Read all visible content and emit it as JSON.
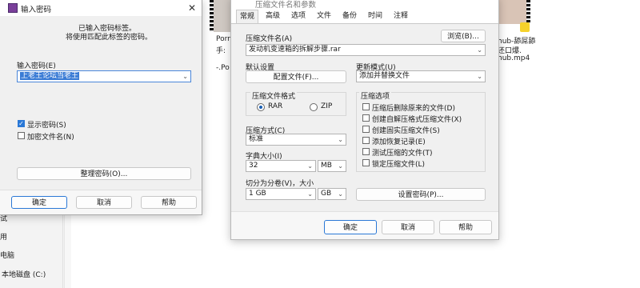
{
  "explorer": {
    "left_fragments": [
      "件",
      "片",
      "档",
      "",
      "",
      "",
      "MS",
      "器",
      "",
      "PS",
      "费",
      "件",
      "试",
      "用",
      "电脑",
      "本地磁盘 (C:)"
    ],
    "thumb_captions": [
      "Porn",
      "手:",
      "-.Po",
      "hub-舔屌舔",
      "还口爆.",
      "hub.mp4"
    ]
  },
  "password_dialog": {
    "title": "输入密码",
    "info_line1": "已输入密码标签。",
    "info_line2": "将使用匹配此标签的密码。",
    "password_label": "输入密码(E)",
    "password_value": "上老王论坛当老王",
    "show_password_label": "显示密码(S)",
    "encrypt_names_label": "加密文件名(N)",
    "organize_button": "整理密码(O)...",
    "ok_button": "确定",
    "cancel_button": "取消",
    "help_button": "帮助",
    "close_glyph": "✕"
  },
  "archive_dialog": {
    "title": "压缩文件名和参数",
    "tabs": [
      "常规",
      "高级",
      "选项",
      "文件",
      "备份",
      "时间",
      "注释"
    ],
    "archive_name_label": "压缩文件名(A)",
    "browse_button": "浏览(B)...",
    "archive_name_value": "发动机变速箱的拆解步骤.rar",
    "default_settings_label": "默认设置",
    "profiles_button": "配置文件(F)...",
    "update_mode_label": "更新模式(U)",
    "update_mode_value": "添加并替换文件",
    "format_group_label": "压缩文件格式",
    "format_rar": "RAR",
    "format_zip": "ZIP",
    "method_label": "压缩方式(C)",
    "method_value": "标准",
    "dict_label": "字典大小(I)",
    "dict_value": "32",
    "dict_unit": "MB",
    "split_label": "切分为分卷(V)，大小",
    "split_value": "1 GB",
    "split_unit": "GB",
    "options_group_label": "压缩选项",
    "options": [
      {
        "label": "压缩后删除原来的文件(D)",
        "checked": false
      },
      {
        "label": "创建自解压格式压缩文件(X)",
        "checked": false
      },
      {
        "label": "创建固实压缩文件(S)",
        "checked": false
      },
      {
        "label": "添加恢复记录(E)",
        "checked": false
      },
      {
        "label": "测试压缩的文件(T)",
        "checked": false
      },
      {
        "label": "锁定压缩文件(L)",
        "checked": false
      }
    ],
    "set_password_button": "设置密码(P)...",
    "ok_button": "确定",
    "cancel_button": "取消",
    "help_button": "帮助"
  },
  "colors": {
    "accent": "#2a78d6",
    "dialog_bg": "#f0f0f0",
    "selection": "#3a7bd5"
  }
}
